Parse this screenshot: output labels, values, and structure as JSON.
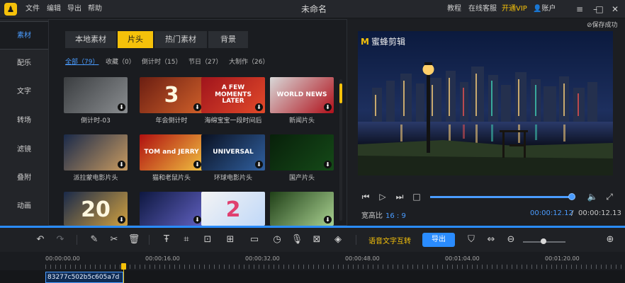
{
  "app": {
    "logo_glyph": "♟",
    "title": "未命名",
    "menu": [
      "文件",
      "编辑",
      "导出",
      "帮助"
    ],
    "right_menu": {
      "tutorial": "教程",
      "support": "在线客服",
      "vip": "开通VIP",
      "account": "账户"
    }
  },
  "sidebar": {
    "items": [
      "素材",
      "配乐",
      "文字",
      "转场",
      "滤镜",
      "叠附",
      "动画"
    ],
    "active_index": 0
  },
  "library": {
    "tabs": [
      "本地素材",
      "片头",
      "热门素材",
      "背景"
    ],
    "active_tab": 1,
    "filters": [
      "全部（79）",
      "收藏（0）",
      "倒计时（15）",
      "节日（27）",
      "大制作（26）"
    ],
    "active_filter": 0,
    "items": [
      {
        "label": "倒计时-03",
        "thumb_text": "",
        "colors": [
          "#3a3d40",
          "#8a8d90"
        ]
      },
      {
        "label": "年会倒计时",
        "thumb_text": "3",
        "colors": [
          "#6b1e12",
          "#d0602a"
        ]
      },
      {
        "label": "海绵宝宝一段时间后",
        "thumb_text": "A FEW MOMENTS LATER",
        "colors": [
          "#a0141c",
          "#e24a2a"
        ]
      },
      {
        "label": "新闻片头",
        "thumb_text": "WORLD NEWS",
        "colors": [
          "#d8d8d8",
          "#b0101a"
        ]
      },
      {
        "label": "派拉蒙电影片头",
        "thumb_text": "",
        "colors": [
          "#1a2a4a",
          "#c89a60"
        ]
      },
      {
        "label": "猫和老鼠片头",
        "thumb_text": "TOM and JERRY",
        "colors": [
          "#b01010",
          "#f0c040"
        ]
      },
      {
        "label": "环球电影片头",
        "thumb_text": "UNIVERSAL",
        "colors": [
          "#0a1020",
          "#3060a0"
        ]
      },
      {
        "label": "国产片头",
        "thumb_text": "",
        "colors": [
          "#08200a",
          "#154a18"
        ]
      },
      {
        "label": "",
        "thumb_text": "20",
        "colors": [
          "#1a2a4a",
          "#d0a040"
        ]
      },
      {
        "label": "",
        "thumb_text": "",
        "colors": [
          "#0e1840",
          "#6060c0"
        ]
      },
      {
        "label": "",
        "thumb_text": "2",
        "colors": [
          "#f4f4f4",
          "#c0d8f8"
        ]
      },
      {
        "label": "",
        "thumb_text": "",
        "colors": [
          "#204018",
          "#a8d090"
        ]
      }
    ]
  },
  "preview": {
    "save_status": "保存成功",
    "watermark": "蜜蜂剪辑",
    "watermark_mark": "M",
    "progress": 1.0,
    "aspect_label": "宽高比",
    "aspect_value": "16 : 9",
    "time_current": "00:00:12.12",
    "time_separator": "/",
    "time_total": "00:00:12.13"
  },
  "toolbar": {
    "speech_to_text": "语音文字互转",
    "export": "导出"
  },
  "timeline": {
    "labels": [
      "00:00:00.00",
      "00:00:16.00",
      "00:00:32.00",
      "00:00:48.00",
      "00:01:04.00",
      "00:01:20.00"
    ],
    "clip_name": "83277c502b5c605a7d"
  }
}
